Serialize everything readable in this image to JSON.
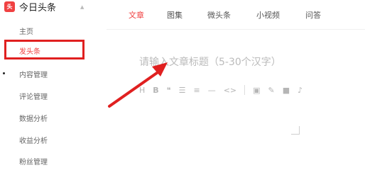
{
  "brand": {
    "logo_text": "头条",
    "name": "今日头条"
  },
  "sidebar": {
    "items": [
      {
        "label": "主页"
      },
      {
        "label": "发头条"
      },
      {
        "label": "内容管理"
      },
      {
        "label": "评论管理"
      },
      {
        "label": "数据分析"
      },
      {
        "label": "收益分析"
      },
      {
        "label": "粉丝管理"
      }
    ]
  },
  "tabs": [
    {
      "label": "文章"
    },
    {
      "label": "图集"
    },
    {
      "label": "微头条"
    },
    {
      "label": "小视频"
    },
    {
      "label": "问答"
    }
  ],
  "editor": {
    "title_placeholder": "请输入文章标题（5-30个汉字）"
  },
  "toolbar": {
    "heading": "H",
    "bold": "B",
    "quote": "❝",
    "ul": "☰",
    "ol": "≡",
    "hr": "—",
    "code": "<>",
    "image": "▣",
    "link": "✎",
    "video": "■",
    "audio": "♪"
  },
  "colors": {
    "accent": "#f04142",
    "highlight": "#e02020"
  }
}
